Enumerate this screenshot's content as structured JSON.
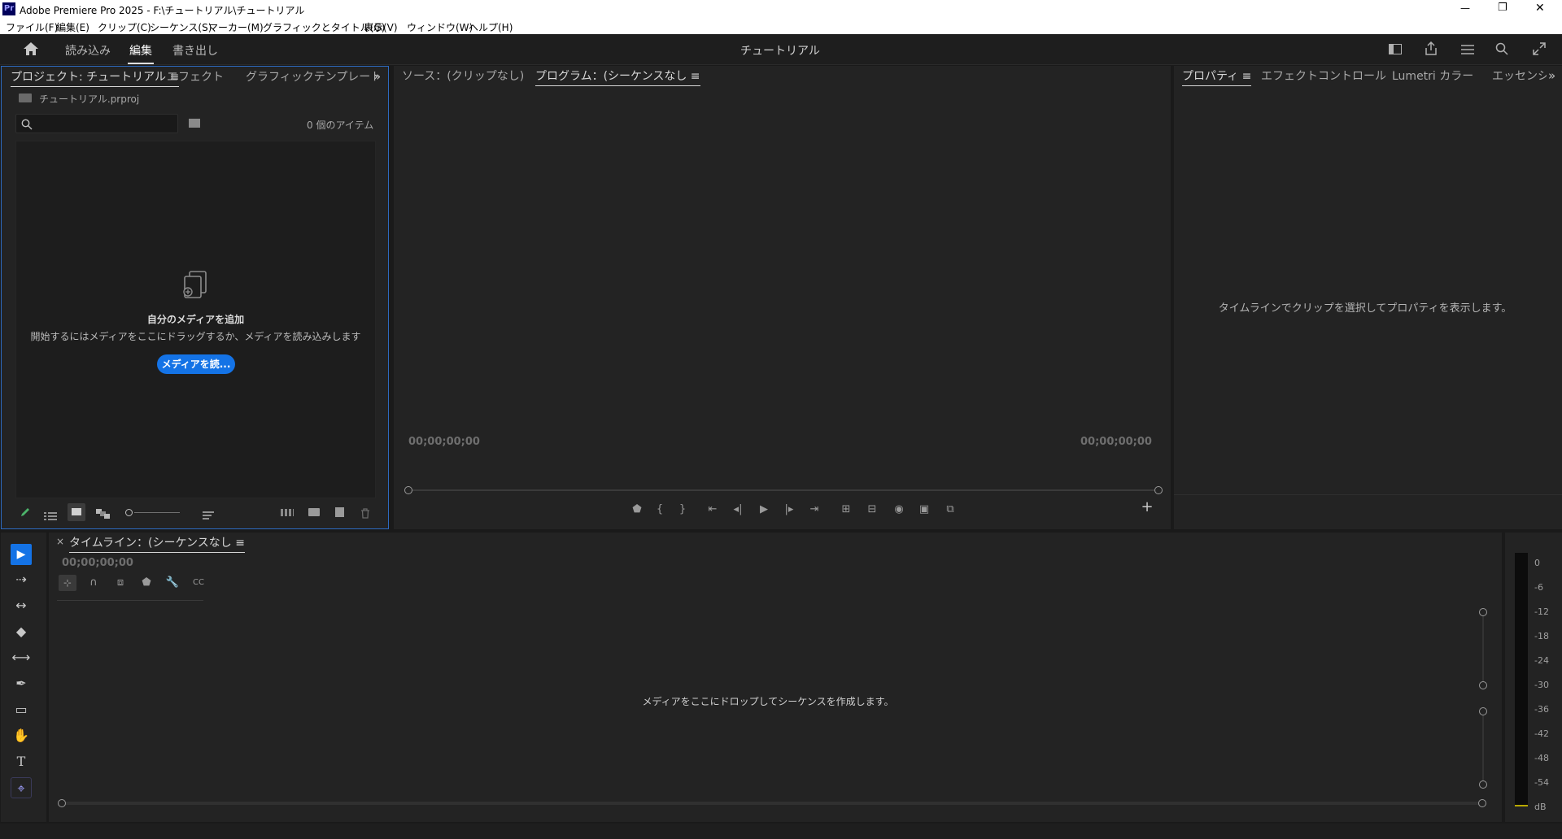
{
  "window": {
    "app_badge": "Pr",
    "title": "Adobe Premiere Pro 2025 - F:\\チュートリアル\\チュートリアル",
    "minimize_glyph": "—",
    "maximize_glyph": "❐",
    "close_glyph": "✕"
  },
  "menu": {
    "items": [
      "ファイル(F)",
      "編集(E)",
      "クリップ(C)",
      "シーケンス(S)",
      "マーカー(M)",
      "グラフィックとタイトル(G)",
      "表示(V)",
      "ウィンドウ(W)",
      "ヘルプ(H)"
    ]
  },
  "header": {
    "workspace_tabs": [
      "読み込み",
      "編集",
      "書き出し"
    ],
    "active_tab": "編集",
    "project_title": "チュートリアル"
  },
  "project_panel": {
    "tabs": [
      "プロジェクト: チュートリアル ≡",
      "エフェクト",
      "グラフィックテンプレート"
    ],
    "overflow_glyph": "»",
    "project_file": "チュートリアル.prproj",
    "search_placeholder": "",
    "item_count": "0 個のアイテム",
    "empty_title": "自分のメディアを追加",
    "empty_desc": "開始するにはメディアをここにドラッグするか、メディアを読み込みします",
    "import_button": "メディアを読..."
  },
  "monitor_panel": {
    "tabs": [
      "ソース：(クリップなし)",
      "プログラム：(シーケンスなし ≡"
    ],
    "timecode_left": "00;00;00;00",
    "timecode_right": "00;00;00;00",
    "add_glyph": "+"
  },
  "properties_panel": {
    "tabs": [
      "プロパティ ≡",
      "エフェクトコントロール",
      "Lumetri カラー",
      "エッセンシャル"
    ],
    "overflow_glyph": "»",
    "message": "タイムラインでクリップを選択してプロパティを表示します。"
  },
  "timeline_panel": {
    "close_glyph": "×",
    "tab": "タイムライン：(シーケンスなし ≡",
    "timecode": "00;00;00;00",
    "drop_message": "メディアをここにドロップしてシーケンスを作成します。"
  },
  "tools": {
    "selection": "▶",
    "track_select": "⇢",
    "ripple": "↔",
    "razor": "◆",
    "slip": "⟷",
    "pen": "✒",
    "rectangle": "▭",
    "hand": "✋",
    "type": "T",
    "other": "⌖"
  },
  "audio_meter": {
    "ticks": [
      "0",
      "-6",
      "-12",
      "-18",
      "-24",
      "-30",
      "-36",
      "-42",
      "-48",
      "-54",
      "dB"
    ]
  },
  "colors": {
    "accent_blue": "#1473e6",
    "panel_bg": "#232323",
    "focus_border": "#2d6ac0"
  }
}
